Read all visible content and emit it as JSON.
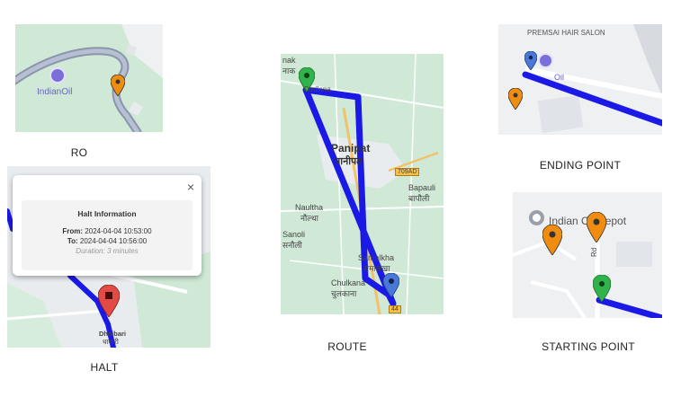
{
  "colors": {
    "route_blue": "#1a19e6",
    "marker_orange": "#f08c10",
    "marker_green": "#2fb34a",
    "marker_red": "#e24b45",
    "marker_blue": "#4a78d8",
    "map_green": "#cfe9d6",
    "map_grey": "#eef0f2"
  },
  "panels": {
    "ro": {
      "caption": "RO",
      "brand_label": "IndianOil",
      "icons": [
        "indianoil-pin-icon",
        "orange-marker-icon"
      ]
    },
    "halt": {
      "caption": "HALT",
      "popup": {
        "title": "Halt Information",
        "from_label": "From:",
        "from_value": "2024-04-04 10:53:00",
        "to_label": "To:",
        "to_value": "2024-04-04 10:56:00",
        "duration_label": "Duration:",
        "duration_value": "3 minutes",
        "close_glyph": "×"
      },
      "place_label": "Dhaibari",
      "place_label_local": "धाबारी"
    },
    "route": {
      "caption": "ROUTE",
      "labels": {
        "top_left": "nak",
        "top_left_local": "नाक",
        "dadlana": "Dadlana",
        "city": "Panipat",
        "city_local": "पानीपत",
        "highway": "709AD",
        "bapauli": "Bapauli",
        "bapauli_local": "बापौली",
        "naultha": "Naultha",
        "naultha_local": "नौल्था",
        "sanoli": "Sanoli",
        "sanoli_local": "सनौली",
        "samalkha": "Samalkha",
        "samalkha_local": "समालखा",
        "chulkana": "Chulkana",
        "chulkana_local": "चुलकाना",
        "nh": "44"
      }
    },
    "ending": {
      "caption": "ENDING POINT",
      "salon_label": "PREMSAI HAIR SALON",
      "oil_label": "Oil"
    },
    "starting": {
      "caption": "STARTING POINT",
      "depot_label": "Indian Oil Depot",
      "road_label": "Rd"
    }
  }
}
